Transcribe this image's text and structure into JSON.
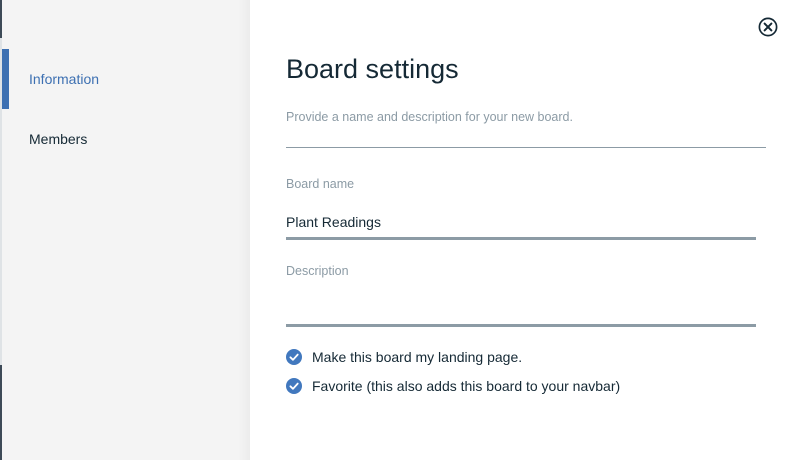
{
  "sidebar": {
    "items": [
      {
        "label": "Information",
        "active": true
      },
      {
        "label": "Members",
        "active": false
      }
    ]
  },
  "dialog": {
    "title": "Board settings",
    "subtitle": "Provide a name and description for your new board.",
    "close_icon": "close-circle-icon"
  },
  "form": {
    "board_name": {
      "label": "Board name",
      "value": "Plant Readings"
    },
    "description": {
      "label": "Description",
      "value": ""
    },
    "options": [
      {
        "label": "Make this board my landing page.",
        "checked": true
      },
      {
        "label": "Favorite (this also adds this board to your navbar)",
        "checked": true
      }
    ]
  },
  "colors": {
    "accent": "#3d70b2",
    "checkbox": "#4178be",
    "text": "#152935",
    "muted": "#8c9ba5",
    "sidebar_bg": "#f4f4f4"
  }
}
